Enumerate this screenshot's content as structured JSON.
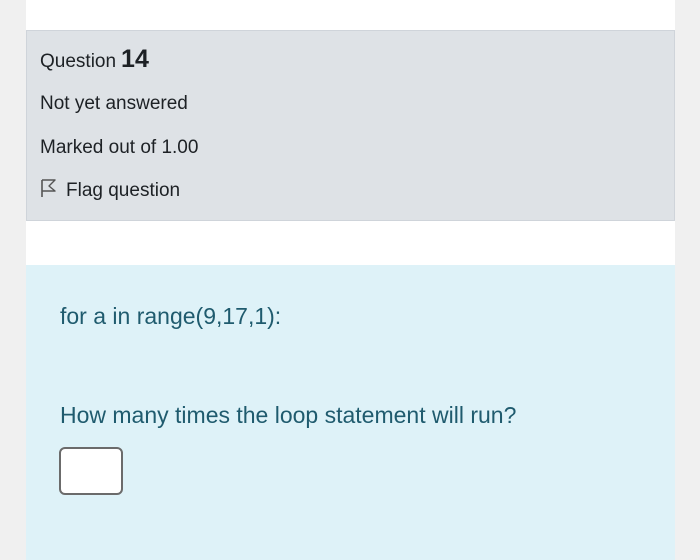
{
  "question": {
    "label": "Question",
    "number": "14",
    "state": "Not yet answered",
    "grade": "Marked out of 1.00",
    "flag_label": "Flag question"
  },
  "content": {
    "code_line": "for a in range(9,17,1):",
    "prompt": "How many times the loop statement will run?",
    "answer_value": ""
  },
  "icons": {
    "flag": "flag-outline-icon"
  },
  "colors": {
    "info_bg": "#dee2e6",
    "content_bg": "#def2f8",
    "content_text": "#1f5b6e"
  }
}
